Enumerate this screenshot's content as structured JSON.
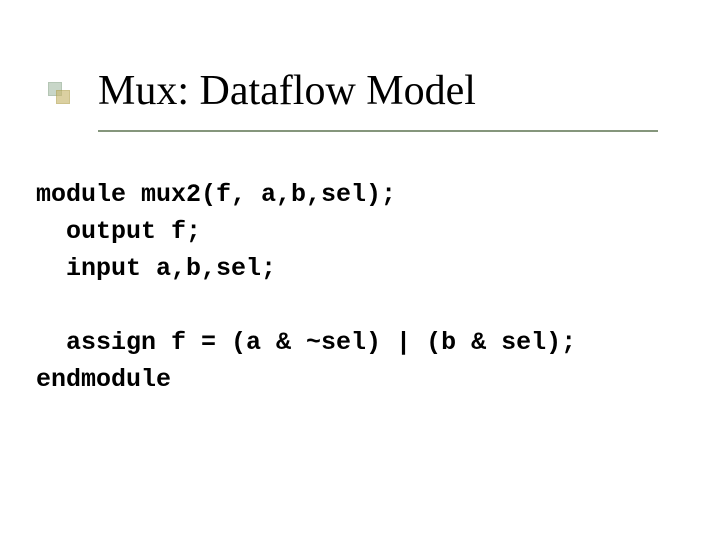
{
  "title": "Mux: Dataflow Model",
  "code": {
    "l1": "module mux2(f, a,b,sel);",
    "l2": "  output f;",
    "l3": "  input a,b,sel;",
    "l4_blank": "",
    "l5": "  assign f = (a & ~sel) | (b & sel);",
    "l6": "endmodule"
  }
}
